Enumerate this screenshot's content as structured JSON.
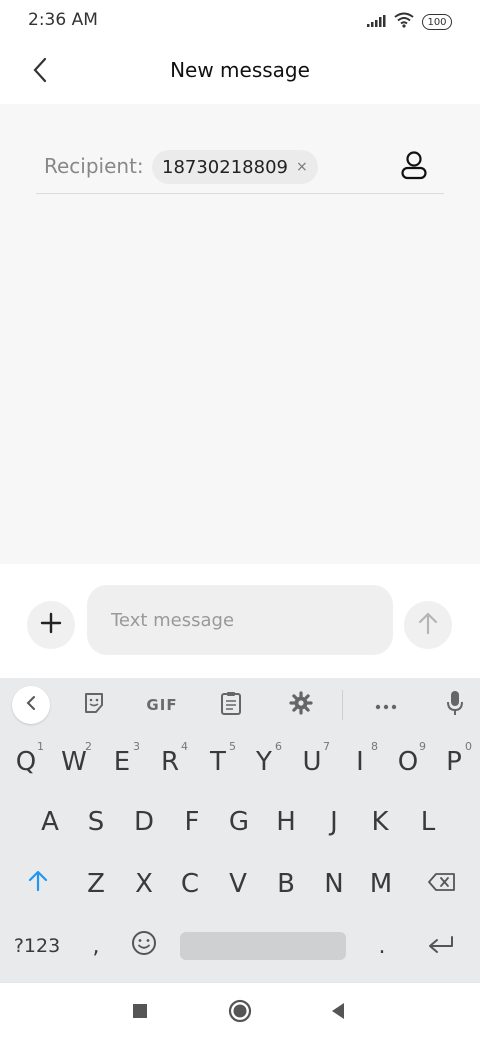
{
  "status_bar": {
    "time": "2:36 AM",
    "battery": "100"
  },
  "header": {
    "title": "New message"
  },
  "recipient": {
    "label": "Recipient:",
    "chip_text": "18730218809",
    "chip_remove": "×"
  },
  "compose": {
    "placeholder": "Text message"
  },
  "keyboard": {
    "toolbar": {
      "gif": "GIF"
    },
    "row1": [
      {
        "k": "Q",
        "s": "1"
      },
      {
        "k": "W",
        "s": "2"
      },
      {
        "k": "E",
        "s": "3"
      },
      {
        "k": "R",
        "s": "4"
      },
      {
        "k": "T",
        "s": "5"
      },
      {
        "k": "Y",
        "s": "6"
      },
      {
        "k": "U",
        "s": "7"
      },
      {
        "k": "I",
        "s": "8"
      },
      {
        "k": "O",
        "s": "9"
      },
      {
        "k": "P",
        "s": "0"
      }
    ],
    "row2": [
      "A",
      "S",
      "D",
      "F",
      "G",
      "H",
      "J",
      "K",
      "L"
    ],
    "row3": [
      "Z",
      "X",
      "C",
      "V",
      "B",
      "N",
      "M"
    ],
    "symbols_label": "?123",
    "comma": ",",
    "period": "."
  },
  "colors": {
    "shift_accent": "#2196f3",
    "content_bg": "#f7f7f7",
    "keyboard_bg": "#e9eaeb"
  }
}
